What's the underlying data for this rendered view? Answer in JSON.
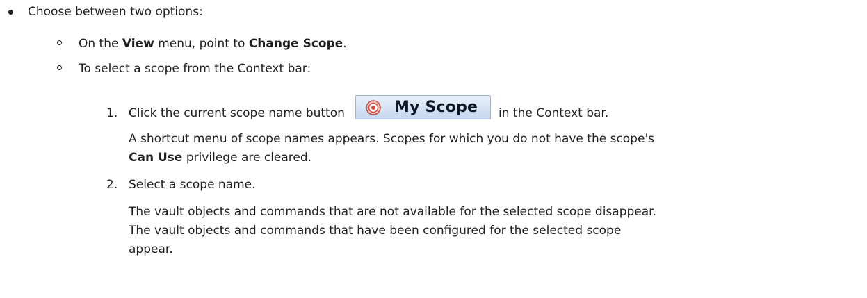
{
  "step_intro": "Choose between two options:",
  "option_view": {
    "pre": "On the ",
    "menu": "View",
    "mid": " menu, point to ",
    "item": "Change Scope",
    "post": "."
  },
  "option_context": {
    "text": "To select a scope from the Context bar:"
  },
  "step1": {
    "number": "1.",
    "pre": "Click the current scope name button",
    "button_label": "My Scope",
    "button_icon": "scope-target-icon",
    "post": "in the Context bar.",
    "note_line1": "A shortcut menu of scope names appears. Scopes for which you do not have the scope's",
    "note_privilege": "Can Use",
    "note_line2_post": " privilege are cleared."
  },
  "step2": {
    "number": "2.",
    "text": "Select a scope name.",
    "result_line1": "The vault objects and commands that are not available for the selected scope disappear.",
    "result_line2": "The vault objects and commands that have been configured for the selected scope",
    "result_line3": "appear."
  },
  "colors": {
    "text": "#1f1f1f",
    "button_top": "#e9f1fb",
    "button_bottom": "#c5d7ee",
    "icon_red": "#d9453a"
  }
}
